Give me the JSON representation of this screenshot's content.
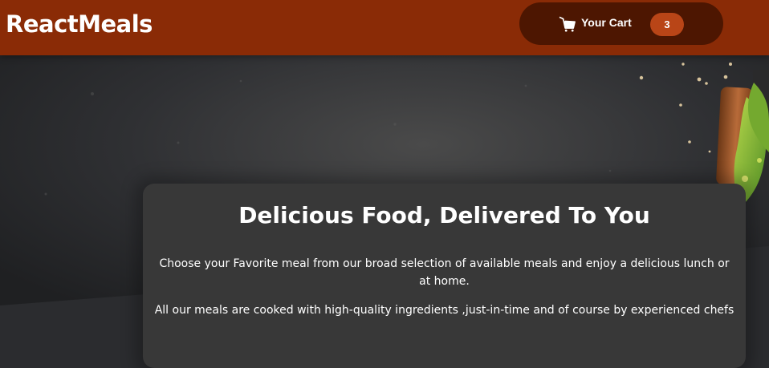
{
  "header": {
    "brand": "ReactMeals",
    "cart": {
      "icon": "cart-icon",
      "label": "Your Cart",
      "count": "3"
    }
  },
  "hero": {
    "image": "food-table-background"
  },
  "summary": {
    "title": "Delicious Food, Delivered To You",
    "paragraph_1": "Choose your Favorite meal from our broad selection of available meals and enjoy a delicious lunch or at home.",
    "paragraph_2": "All our meals are cooked with high-quality ingredients ,just-in-time and of course by experienced chefs"
  },
  "colors": {
    "header": "#8a2b06",
    "cart_button": "#4d1601",
    "cart_badge": "#b94517",
    "background": "#2b2c2f",
    "summary_card": "#383838"
  }
}
